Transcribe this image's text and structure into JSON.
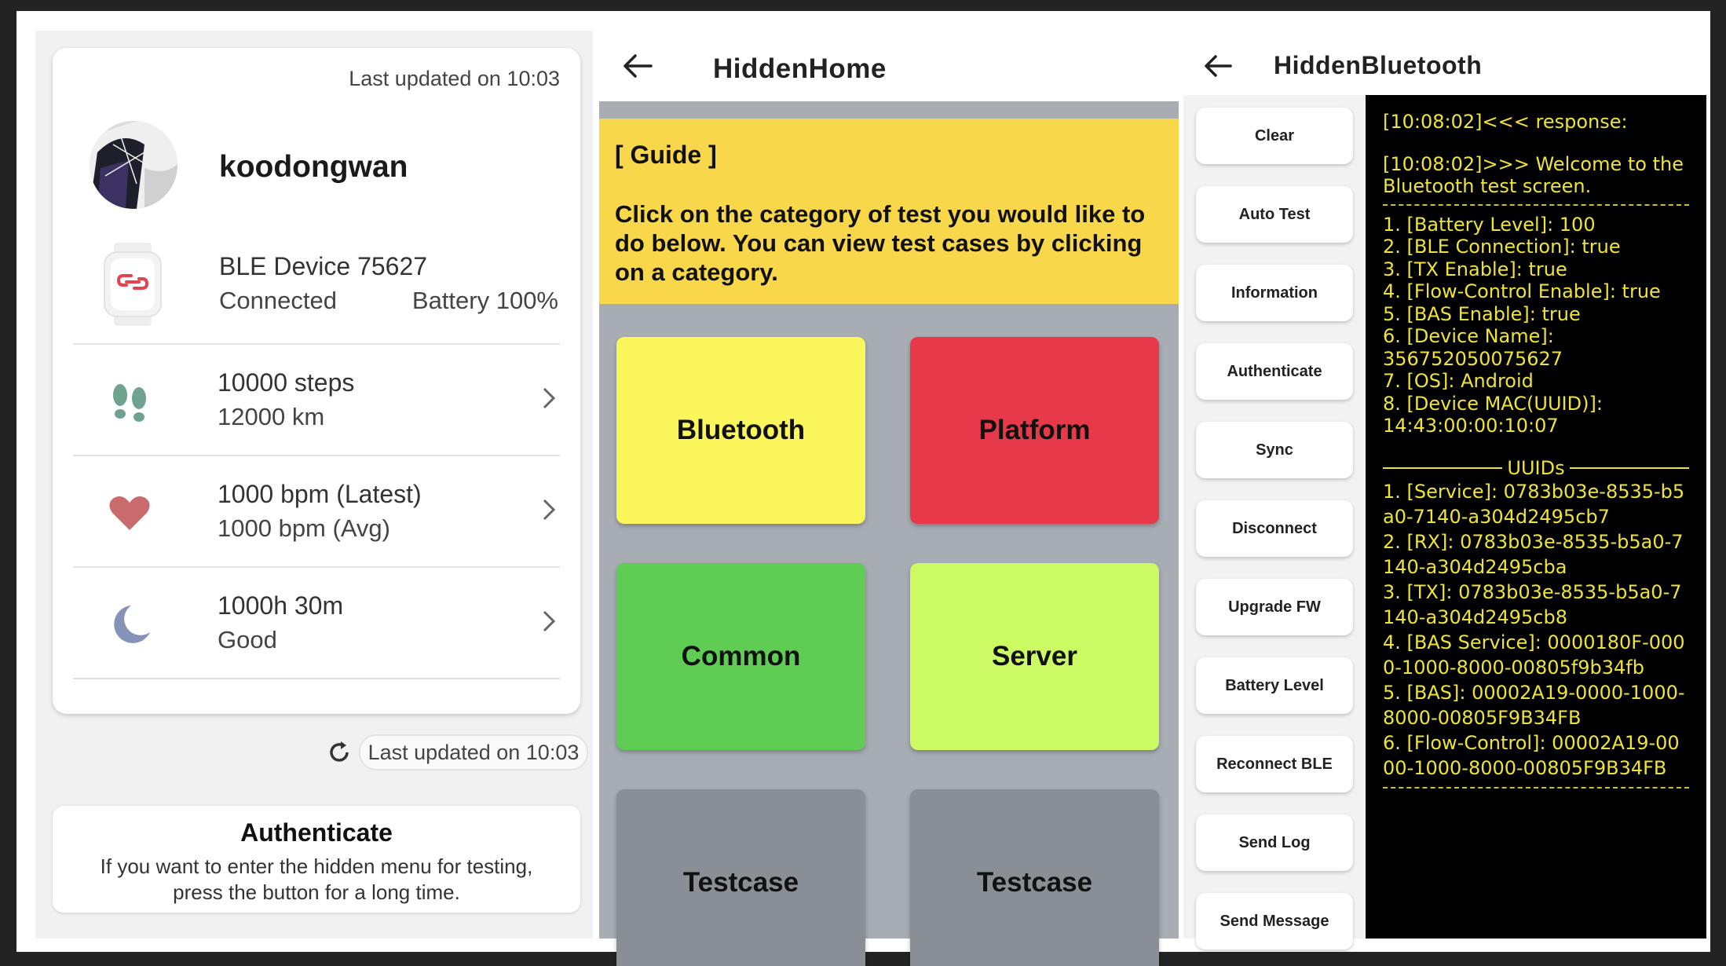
{
  "home": {
    "last_updated_top": "Last updated on 10:03",
    "username": "koodongwan",
    "device": {
      "name": "BLE Device 75627",
      "status": "Connected",
      "battery": "Battery 100%"
    },
    "metrics": [
      {
        "line1": "10000 steps",
        "line2": "12000 km",
        "icon": "footsteps-icon"
      },
      {
        "line1": "1000 bpm (Latest)",
        "line2": "1000 bpm (Avg)",
        "icon": "heart-icon"
      },
      {
        "line1": "1000h 30m",
        "line2": "Good",
        "icon": "moon-icon"
      }
    ],
    "last_updated_bottom": "Last updated on 10:03",
    "auth": {
      "title": "Authenticate",
      "desc1": "If you want to enter the hidden menu for testing,",
      "desc2": "press the button for a long time."
    }
  },
  "hidden_home": {
    "title": "HiddenHome",
    "guide_title": "[ Guide ]",
    "guide_text": "Click on the category of test you would like to do below. You can view test cases by clicking on a category.",
    "tiles": [
      {
        "label": "Bluetooth",
        "color": "#fbf65c"
      },
      {
        "label": "Platform",
        "color": "#e8394a"
      },
      {
        "label": "Common",
        "color": "#5fcd54"
      },
      {
        "label": "Server",
        "color": "#cbfa62"
      },
      {
        "label": "Testcase",
        "color": "#8a8f96"
      },
      {
        "label": "Testcase",
        "color": "#8a8f96"
      }
    ]
  },
  "hidden_bluetooth": {
    "title": "HiddenBluetooth",
    "buttons": [
      "Clear",
      "Auto Test",
      "Information",
      "Authenticate",
      "Sync",
      "Disconnect",
      "Upgrade FW",
      "Battery Level",
      "Reconnect BLE",
      "Send Log",
      "Send Message"
    ],
    "console": {
      "response": "[10:08:02]<<< response:",
      "welcome1": "[10:08:02]>>> Welcome to the",
      "welcome2": "Bluetooth test screen.",
      "info": [
        "1. [Battery Level]: 100",
        "2. [BLE Connection]: true",
        "3. [TX Enable]: true",
        "4. [Flow-Control Enable]: true",
        "5. [BAS Enable]: true",
        "6. [Device Name]:",
        "356752050075627",
        "7. [OS]: Android",
        "8. [Device MAC(UUID)]:",
        "14:43:00:00:10:07"
      ],
      "uuids_header": "UUIDs",
      "uuids": [
        "1. [Service]: 0783b03e-8535-b5",
        "a0-7140-a304d2495cb7",
        "2. [RX]: 0783b03e-8535-b5a0-7",
        "140-a304d2495cba",
        "3. [TX]: 0783b03e-8535-b5a0-7",
        "140-a304d2495cb8",
        "4. [BAS Service]: 0000180F-000",
        "0-1000-8000-00805f9b34fb",
        "5. [BAS]: 00002A19-0000-1000-",
        "8000-00805F9B34FB",
        "6. [Flow-Control]: 00002A19-00",
        "00-1000-8000-00805F9B34FB"
      ]
    }
  }
}
